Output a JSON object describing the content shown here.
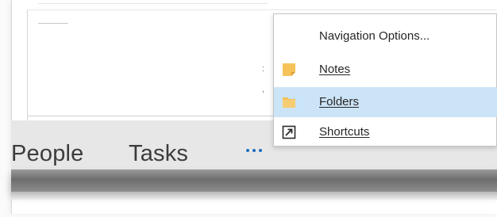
{
  "nav": {
    "items": [
      {
        "label": "People"
      },
      {
        "label": "Tasks"
      }
    ],
    "more_icon": "ellipsis-icon"
  },
  "side_marks": [
    ":",
    ","
  ],
  "menu": {
    "items": [
      {
        "label": "Navigation Options...",
        "icon": "none",
        "selected": false
      },
      {
        "label": "Notes",
        "icon": "notes-icon",
        "selected": false
      },
      {
        "label": "Folders",
        "icon": "folder-icon",
        "selected": true
      },
      {
        "label": "Shortcuts",
        "icon": "shortcut-icon",
        "selected": false
      }
    ]
  },
  "colors": {
    "accent": "#1e6fbf",
    "selected_bg": "#cce4f7",
    "nav_bar": "#e7e7e7",
    "icon_yellow": "#f6c35a"
  }
}
